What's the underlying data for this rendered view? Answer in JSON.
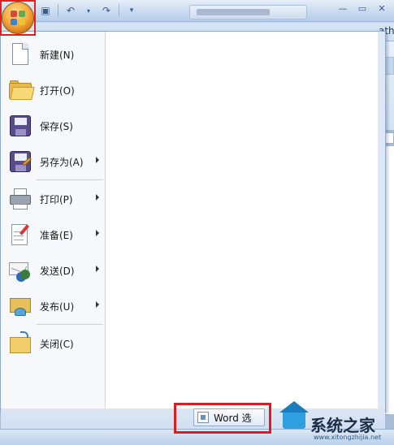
{
  "quick_access": {
    "save_icon": "save-icon",
    "undo_icon": "undo-icon",
    "redo_icon": "redo-icon",
    "customize_icon": "dropdown-icon"
  },
  "ribbon": {
    "partial_tab": "ath",
    "ruler_number": "8"
  },
  "office_menu": {
    "items": [
      {
        "label": "新建(N)",
        "icon": "new-document-icon",
        "submenu": false
      },
      {
        "label": "打开(O)",
        "icon": "open-folder-icon",
        "submenu": false
      },
      {
        "label": "保存(S)",
        "icon": "save-disk-icon",
        "submenu": false
      },
      {
        "label": "另存为(A)",
        "icon": "save-as-icon",
        "submenu": true
      },
      {
        "label": "打印(P)",
        "icon": "printer-icon",
        "submenu": true
      },
      {
        "label": "准备(E)",
        "icon": "prepare-icon",
        "submenu": true
      },
      {
        "label": "发送(D)",
        "icon": "send-icon",
        "submenu": true
      },
      {
        "label": "发布(U)",
        "icon": "publish-icon",
        "submenu": true
      },
      {
        "label": "关闭(C)",
        "icon": "close-folder-icon",
        "submenu": false
      }
    ],
    "word_options_label": "Word 选"
  },
  "watermark": {
    "text": "系统之家",
    "url": "www.xitongzhijia.net"
  },
  "colors": {
    "highlight_frame": "#d81e1e",
    "menu_bg": "#dfe9f6",
    "ribbon_bg": "#d4e3f4"
  }
}
